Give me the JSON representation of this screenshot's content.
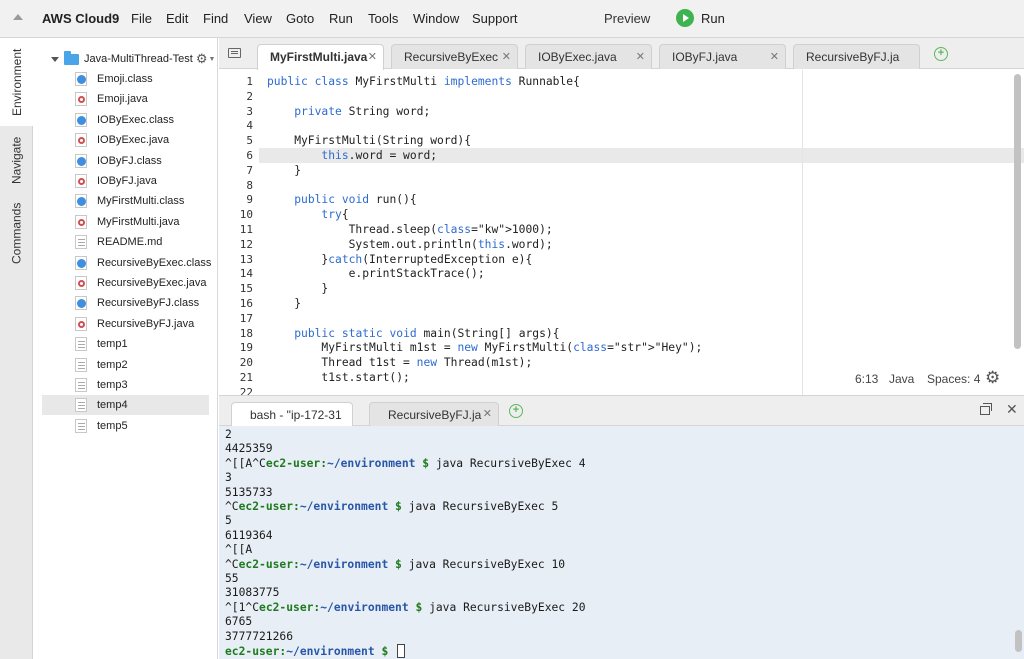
{
  "menubar": {
    "brand": "AWS Cloud9",
    "items": [
      "File",
      "Edit",
      "Find",
      "View",
      "Goto",
      "Run",
      "Tools",
      "Window",
      "Support"
    ],
    "preview": "Preview",
    "run": "Run"
  },
  "side_tabs": [
    "Environment",
    "Navigate",
    "Commands"
  ],
  "tree": {
    "root": "Java-MultiThread-Test",
    "files": [
      {
        "name": "Emoji.class",
        "type": "class"
      },
      {
        "name": "Emoji.java",
        "type": "java"
      },
      {
        "name": "IOByExec.class",
        "type": "class"
      },
      {
        "name": "IOByExec.java",
        "type": "java"
      },
      {
        "name": "IOByFJ.class",
        "type": "class"
      },
      {
        "name": "IOByFJ.java",
        "type": "java"
      },
      {
        "name": "MyFirstMulti.class",
        "type": "class"
      },
      {
        "name": "MyFirstMulti.java",
        "type": "java"
      },
      {
        "name": "README.md",
        "type": "text"
      },
      {
        "name": "RecursiveByExec.class",
        "type": "class"
      },
      {
        "name": "RecursiveByExec.java",
        "type": "java"
      },
      {
        "name": "RecursiveByFJ.class",
        "type": "class"
      },
      {
        "name": "RecursiveByFJ.java",
        "type": "java"
      },
      {
        "name": "temp1",
        "type": "text"
      },
      {
        "name": "temp2",
        "type": "text"
      },
      {
        "name": "temp3",
        "type": "text"
      },
      {
        "name": "temp4",
        "type": "text"
      },
      {
        "name": "temp5",
        "type": "text"
      }
    ],
    "selected": "temp4"
  },
  "editor_tabs": [
    "MyFirstMulti.java",
    "RecursiveByExec",
    "IOByExec.java",
    "IOByFJ.java",
    "RecursiveByFJ.ja"
  ],
  "editor": {
    "line_numbers": [
      "1",
      "2",
      "3",
      "4",
      "5",
      "6",
      "7",
      "8",
      "9",
      "10",
      "11",
      "12",
      "13",
      "14",
      "15",
      "16",
      "17",
      "18",
      "19",
      "20",
      "21",
      "22"
    ],
    "lines": [
      "public class MyFirstMulti implements Runnable{",
      "",
      "    private String word;",
      "",
      "    MyFirstMulti(String word){",
      "        this.word = word;",
      "    }",
      "",
      "    public void run(){",
      "        try{",
      "            Thread.sleep(1000);",
      "            System.out.println(this.word);",
      "        }catch(InterruptedException e){",
      "            e.printStackTrace();",
      "        }",
      "    }",
      "",
      "    public static void main(String[] args){",
      "        MyFirstMulti m1st = new MyFirstMulti(\"Hey\");",
      "        Thread t1st = new Thread(m1st);",
      "        t1st.start();",
      ""
    ],
    "status": {
      "position": "6:13",
      "language": "Java",
      "spaces": "Spaces: 4"
    }
  },
  "terminal_tabs": [
    "bash - \"ip-172-31",
    "RecursiveByFJ.ja"
  ],
  "terminal": {
    "lines": [
      "2",
      "4425359",
      "^[[A^Cec2-user:~/environment $ java RecursiveByExec 4",
      "3",
      "5135733",
      "^Cec2-user:~/environment $ java RecursiveByExec 5",
      "5",
      "6119364",
      "^[[A",
      "^Cec2-user:~/environment $ java RecursiveByExec 10",
      "55",
      "31083775",
      "^[1^Cec2-user:~/environment $ java RecursiveByExec 20",
      "6765",
      "3777721266",
      "ec2-user:~/environment $ "
    ]
  },
  "colors": {
    "run_green": "#3eb34f",
    "keyword_blue": "#2d6bd1",
    "string_green": "#197a19",
    "prompt_green": "#1e7a1e",
    "path_blue": "#2856a8"
  }
}
